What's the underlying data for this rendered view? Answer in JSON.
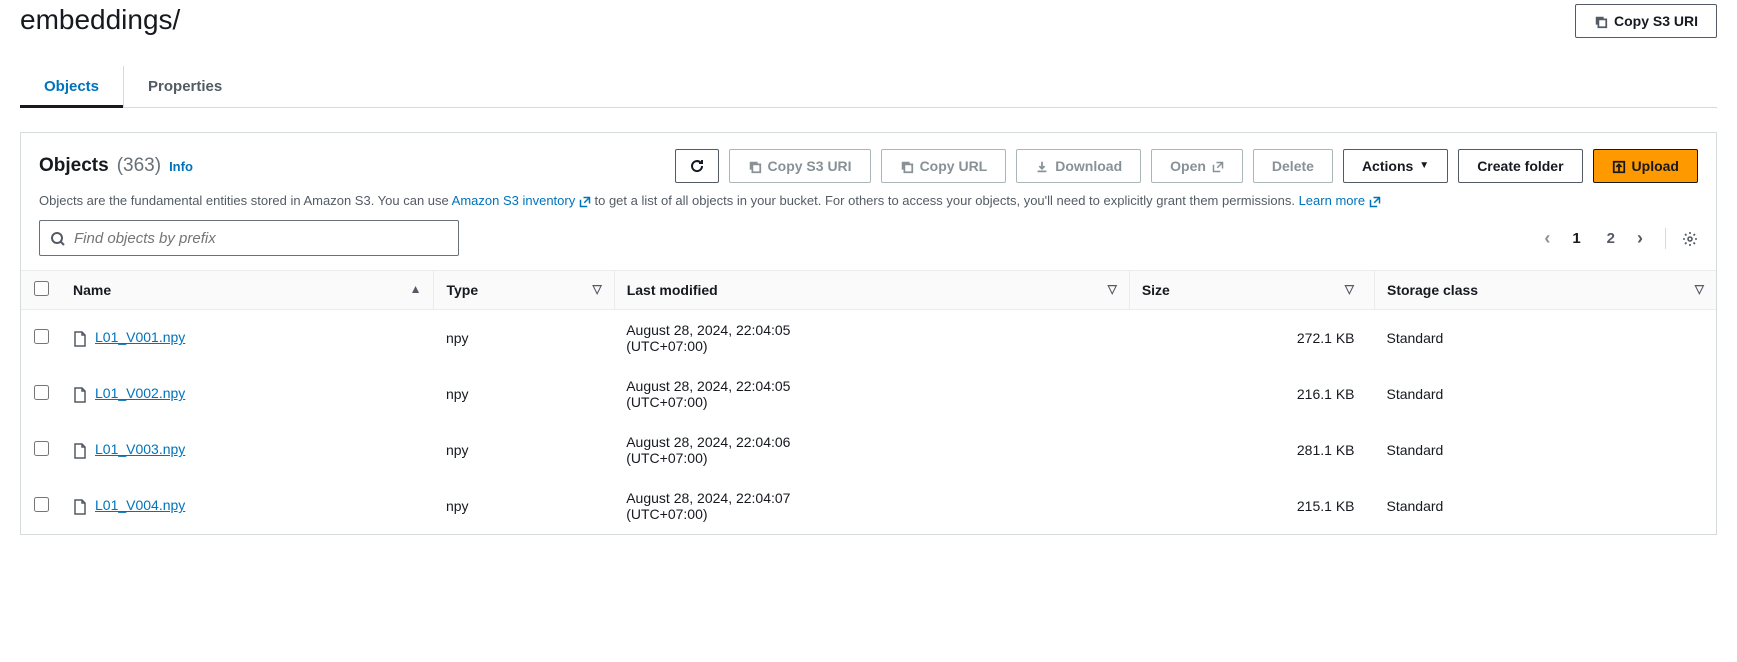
{
  "header": {
    "title": "embeddings/",
    "copy_uri_label": "Copy S3 URI"
  },
  "tabs": {
    "objects": "Objects",
    "properties": "Properties"
  },
  "panel": {
    "title": "Objects",
    "count": "(363)",
    "info": "Info",
    "desc_prefix": "Objects are the fundamental entities stored in Amazon S3. You can use ",
    "desc_link1": "Amazon S3 inventory",
    "desc_mid": " to get a list of all objects in your bucket. For others to access your objects, you'll need to explicitly grant them permissions. ",
    "desc_link2": "Learn more"
  },
  "toolbar": {
    "copy_uri": "Copy S3 URI",
    "copy_url": "Copy URL",
    "download": "Download",
    "open": "Open",
    "delete": "Delete",
    "actions": "Actions",
    "create_folder": "Create folder",
    "upload": "Upload"
  },
  "search": {
    "placeholder": "Find objects by prefix"
  },
  "pagination": {
    "page1": "1",
    "page2": "2"
  },
  "columns": {
    "name": "Name",
    "type": "Type",
    "last_modified": "Last modified",
    "size": "Size",
    "storage_class": "Storage class"
  },
  "rows": [
    {
      "name": "L01_V001.npy",
      "type": "npy",
      "modified_l1": "August 28, 2024, 22:04:05",
      "modified_l2": "(UTC+07:00)",
      "size": "272.1 KB",
      "storage": "Standard"
    },
    {
      "name": "L01_V002.npy",
      "type": "npy",
      "modified_l1": "August 28, 2024, 22:04:05",
      "modified_l2": "(UTC+07:00)",
      "size": "216.1 KB",
      "storage": "Standard"
    },
    {
      "name": "L01_V003.npy",
      "type": "npy",
      "modified_l1": "August 28, 2024, 22:04:06",
      "modified_l2": "(UTC+07:00)",
      "size": "281.1 KB",
      "storage": "Standard"
    },
    {
      "name": "L01_V004.npy",
      "type": "npy",
      "modified_l1": "August 28, 2024, 22:04:07",
      "modified_l2": "(UTC+07:00)",
      "size": "215.1 KB",
      "storage": "Standard"
    }
  ]
}
